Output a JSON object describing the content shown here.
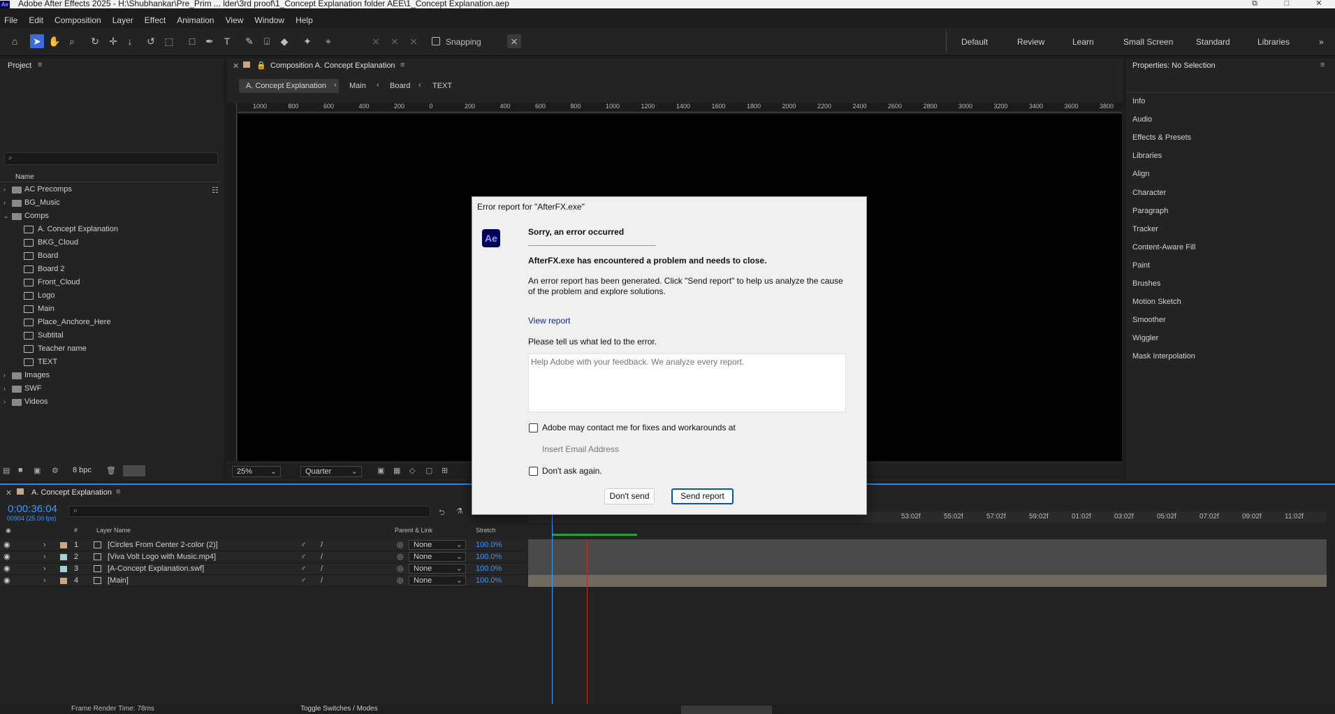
{
  "window": {
    "title": "Adobe After Effects 2025 - H:\\Shubhankar\\Pre_Prim ... lder\\3rd proof\\1_Concept Explanation folder AEE\\1_Concept Explanation.aep",
    "logo": "Ae"
  },
  "menu": [
    "File",
    "Edit",
    "Composition",
    "Layer",
    "Effect",
    "Animation",
    "View",
    "Window",
    "Help"
  ],
  "toolbar": {
    "snapping_label": "Snapping",
    "workspaces": [
      "Default",
      "Review",
      "Learn",
      "Small Screen",
      "Standard",
      "Libraries"
    ]
  },
  "project": {
    "title": "Project",
    "column_name": "Name",
    "bpc": "8 bpc",
    "items": [
      {
        "label": "AC Precomps",
        "type": "folder",
        "depth": 0,
        "expanded": false
      },
      {
        "label": "BG_Music",
        "type": "folder",
        "depth": 0,
        "expanded": false
      },
      {
        "label": "Comps",
        "type": "folder",
        "depth": 0,
        "expanded": true
      },
      {
        "label": "A. Concept Explanation",
        "type": "comp",
        "depth": 1
      },
      {
        "label": "BKG_Cloud",
        "type": "comp",
        "depth": 1
      },
      {
        "label": "Board",
        "type": "comp",
        "depth": 1
      },
      {
        "label": "Board 2",
        "type": "comp",
        "depth": 1
      },
      {
        "label": "Front_Cloud",
        "type": "comp",
        "depth": 1
      },
      {
        "label": "Logo",
        "type": "comp",
        "depth": 1
      },
      {
        "label": "Main",
        "type": "comp",
        "depth": 1
      },
      {
        "label": "Place_Anchore_Here",
        "type": "comp",
        "depth": 1
      },
      {
        "label": "Subtital",
        "type": "comp",
        "depth": 1
      },
      {
        "label": "Teacher name",
        "type": "comp",
        "depth": 1
      },
      {
        "label": "TEXT",
        "type": "comp",
        "depth": 1
      },
      {
        "label": "Images",
        "type": "folder",
        "depth": 0,
        "expanded": false
      },
      {
        "label": "SWF",
        "type": "folder",
        "depth": 0,
        "expanded": false
      },
      {
        "label": "Videos",
        "type": "folder",
        "depth": 0,
        "expanded": false
      }
    ]
  },
  "composition": {
    "panel_title": "Composition A. Concept Explanation",
    "breadcrumbs": [
      "A. Concept Explanation",
      "Main",
      "Board",
      "TEXT"
    ],
    "ruler_labels": [
      "1000",
      "800",
      "600",
      "400",
      "200",
      "0",
      "200",
      "400",
      "600",
      "800",
      "1000",
      "1200",
      "1400",
      "1600",
      "1800",
      "2000",
      "2200",
      "2400",
      "2600",
      "2800",
      "3000",
      "3200",
      "3400",
      "3600",
      "3800"
    ],
    "zoom": "25%",
    "resolution": "Quarter"
  },
  "properties": {
    "title": "Properties: No Selection",
    "panels": [
      "Info",
      "Audio",
      "Effects & Presets",
      "Libraries",
      "Align",
      "Character",
      "Paragraph",
      "Tracker",
      "Content-Aware Fill",
      "Paint",
      "Brushes",
      "Motion Sketch",
      "Smoother",
      "Wiggler",
      "Mask Interpolation"
    ]
  },
  "timeline": {
    "tab": "A. Concept Explanation",
    "timecode": "0:00:36:04",
    "frame_info": "00904 (25.00 fps)",
    "columns": {
      "num": "#",
      "layer_name": "Layer Name",
      "parent": "Parent & Link",
      "stretch": "Stretch"
    },
    "layers": [
      {
        "num": "1",
        "name": "[Circles From Center 2-color (2)]",
        "parent": "None",
        "stretch": "100.0%",
        "color": "#c9a886"
      },
      {
        "num": "2",
        "name": "[Viva Volt Logo with Music.mp4]",
        "parent": "None",
        "stretch": "100.0%",
        "color": "#a3d2d2"
      },
      {
        "num": "3",
        "name": "[A-Concept Explanation.swf]",
        "parent": "None",
        "stretch": "100.0%",
        "color": "#a3d2d2"
      },
      {
        "num": "4",
        "name": "[Main]",
        "parent": "None",
        "stretch": "100.0%",
        "color": "#c9a886"
      }
    ],
    "time_labels": [
      "53:02f",
      "55:02f",
      "57:02f",
      "59:02f",
      "01:02f",
      "03:02f",
      "05:02f",
      "07:02f",
      "09:02f",
      "11:02f"
    ],
    "footer_left": "Frame Render Time: 78ms",
    "footer_mid": "Toggle Switches / Modes"
  },
  "dialog": {
    "title": "Error report for \"AfterFX.exe\"",
    "logo": "Ae",
    "heading": "Sorry, an error occurred",
    "subheading": "AfterFX.exe has encountered a problem and needs to close.",
    "body_line1": "An error report has been generated. Click \"Send report\" to help us analyze the cause",
    "body_line2": "of the problem and explore solutions.",
    "view_report": "View report",
    "prompt": "Please tell us what led to the error.",
    "feedback_placeholder": "Help Adobe with your feedback. We analyze every report.",
    "contact_label": "Adobe may contact me for fixes and workarounds at",
    "email_placeholder": "Insert Email Address",
    "dont_ask_label": "Don't ask again.",
    "dont_send": "Don't send",
    "send_report": "Send report"
  }
}
